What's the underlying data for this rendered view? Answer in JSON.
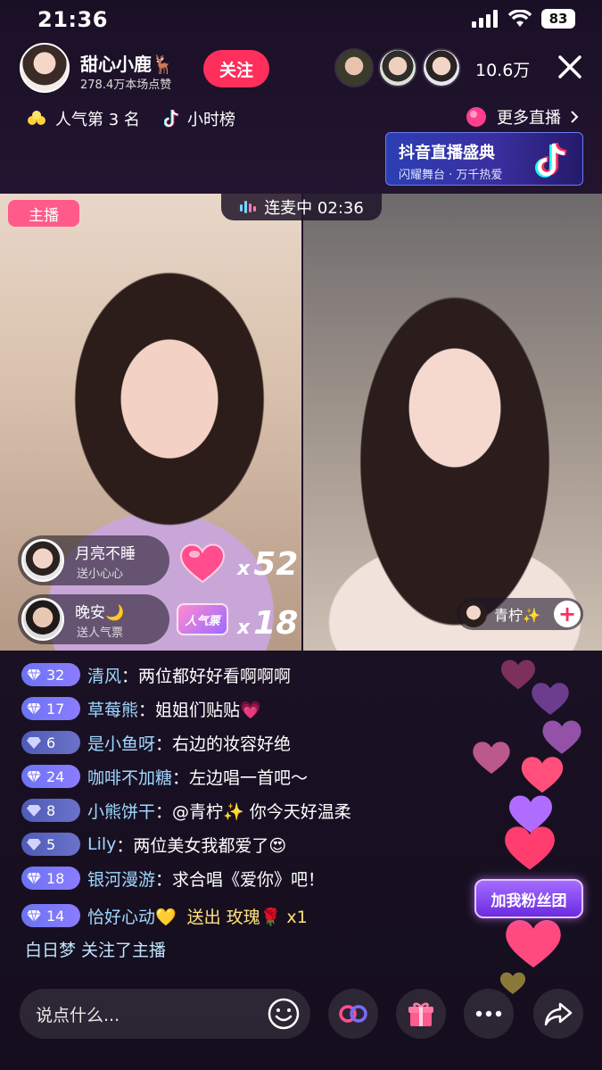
{
  "status_bar": {
    "time": "21:36",
    "battery": "83"
  },
  "host": {
    "name": "甜心小鹿🦌",
    "likes": "278.4万本场点赞",
    "follow_label": "关注"
  },
  "viewers": {
    "count": "10.6万"
  },
  "rank": {
    "popularity": "人气第 3 名",
    "hourly": "小时榜",
    "more_live": "更多直播"
  },
  "banner": {
    "title": "抖音直播盛典",
    "subtitle": "闪耀舞台 · 万千热爱"
  },
  "video": {
    "host_tag": "主播",
    "mic_status": "连麦中 02:36",
    "guest_name": "青柠✨",
    "gifts": [
      {
        "user": "月亮不睡",
        "desc": "送小心心",
        "count": "52"
      },
      {
        "user": "晚安🌙",
        "desc": "送人气票",
        "count": "18",
        "badge": "人气票"
      }
    ],
    "multiplier": "x"
  },
  "chat": [
    {
      "level": "32",
      "name": "清风",
      "text": "两位都好好看啊啊啊"
    },
    {
      "level": "17",
      "name": "草莓熊",
      "text": "姐姐们贴贴💗"
    },
    {
      "level": "6",
      "name": "是小鱼呀",
      "text": "右边的妆容好绝"
    },
    {
      "level": "24",
      "name": "咖啡不加糖",
      "text": "左边唱一首吧～"
    },
    {
      "level": "8",
      "name": "小熊饼干",
      "text": "@青柠✨ 你今天好温柔"
    },
    {
      "level": "5",
      "name": "Lily",
      "text": "两位美女我都爱了😍"
    },
    {
      "level": "18",
      "name": "银河漫游",
      "text": "求合唱《爱你》吧！"
    },
    {
      "level": "14",
      "name": "恰好心动💛",
      "text": "送出 玫瑰🌹 x1"
    }
  ],
  "follow_note": "白日梦 关注了主播",
  "fans_club": "加我粉丝团",
  "bottom": {
    "placeholder": "说点什么..."
  },
  "colors": {
    "follow": "#ff2f5c",
    "host_tag": "#ff5a8a",
    "name": "#9fd8ff",
    "gold": "#ffe07a"
  }
}
